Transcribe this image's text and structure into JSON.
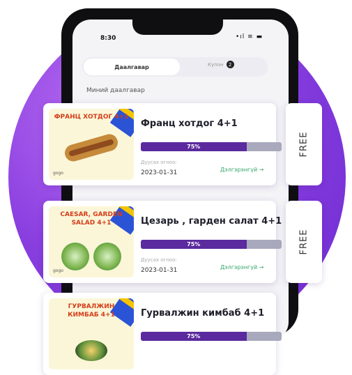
{
  "status_bar": {
    "time": "8:30",
    "icons": "•ıl ≋ ▬"
  },
  "tabs": {
    "active": "Даалгавар",
    "coupon": "Купон",
    "coupon_count": "2"
  },
  "section_title": "Миний даалгавар",
  "cards": [
    {
      "name": "Франц хотдог 4+1",
      "progress_label": "75%",
      "progress": 0.75,
      "expiry_label": "Дуусах огноо:",
      "expiry_date": "2023-01-31",
      "detail_label": "Дэлгэрэнгүй →",
      "reward": "FREE",
      "thumb_title": "ФРАНЦ ХОТДОГ 4+1",
      "thumb_brand": "gogo"
    },
    {
      "name": "Цезарь , гарден салат 4+1",
      "progress_label": "75%",
      "progress": 0.75,
      "expiry_label": "Дуусах огноо:",
      "expiry_date": "2023-01-31",
      "detail_label": "Дэлгэрэнгүй →",
      "reward": "FREE",
      "thumb_title": "CAESAR, GARDEN SALAD 4+1",
      "thumb_brand": "gogo"
    },
    {
      "name": "Гурвалжин кимбаб 4+1",
      "progress_label": "75%",
      "progress": 0.75,
      "thumb_title": "ГУРВАЛЖИН КИМБАБ 4+1"
    }
  ],
  "colors": {
    "accent_purple": "#5a2a9e",
    "bar_track": "#a9a9bd",
    "detail_green": "#33a56a",
    "background_gradient": "#8a3fe0"
  }
}
